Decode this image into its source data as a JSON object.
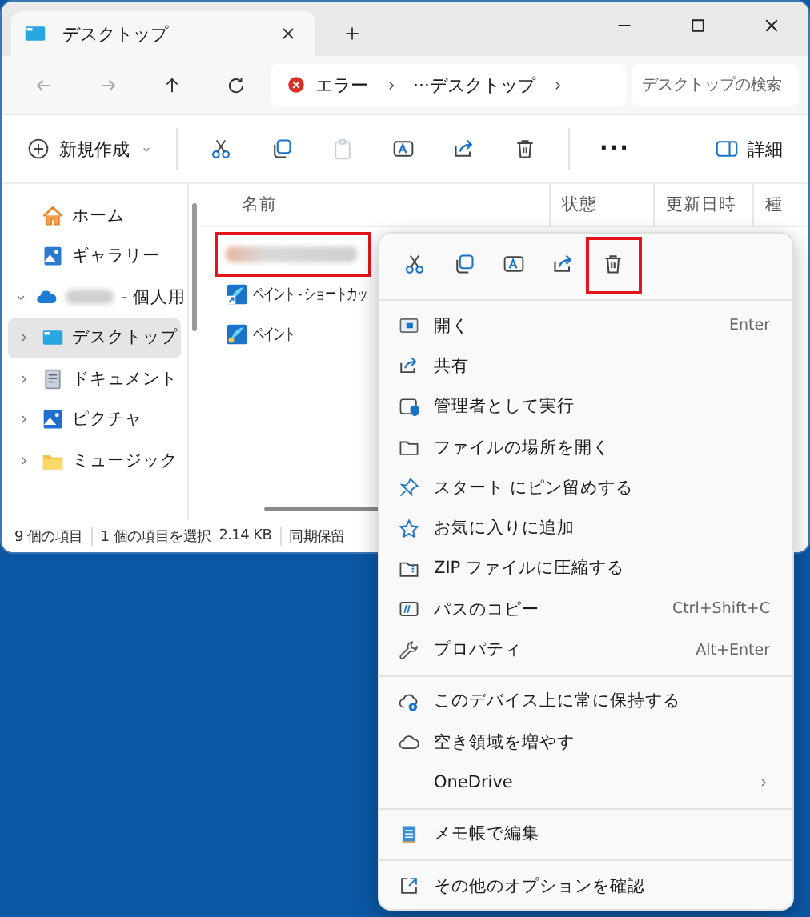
{
  "window": {
    "tab_title": "デスクトップ"
  },
  "navigation": {
    "breadcrumbs": [
      {
        "kind": "error",
        "label": "エラー"
      },
      {
        "kind": "overflow",
        "label": "···"
      },
      {
        "kind": "folder",
        "label": "デスクトップ"
      }
    ],
    "search": {
      "placeholder": "デスクトップの検索"
    }
  },
  "toolbar": {
    "new_label": "新規作成",
    "buttons": [
      {
        "kind": "cut",
        "disabled": false
      },
      {
        "kind": "copy",
        "disabled": false
      },
      {
        "kind": "paste",
        "disabled": true
      },
      {
        "kind": "rename",
        "disabled": false
      },
      {
        "kind": "share",
        "disabled": false
      },
      {
        "kind": "delete",
        "disabled": false
      }
    ],
    "more": "···",
    "details": "詳細"
  },
  "sidebar": {
    "items": [
      {
        "kind": "home",
        "label": "ホーム",
        "selected": false
      },
      {
        "kind": "gallery",
        "label": "ギャラリー",
        "selected": false
      },
      {
        "kind": "cloud",
        "label": "- 個人用",
        "expanded": true,
        "selected": false,
        "blurred_name": true
      },
      {
        "kind": "desktop",
        "label": "デスクトップ",
        "expanded": false,
        "selected": true
      },
      {
        "kind": "document",
        "label": "ドキュメント",
        "expanded": false,
        "selected": false
      },
      {
        "kind": "picture",
        "label": "ピクチャ",
        "expanded": false,
        "selected": false
      },
      {
        "kind": "folder",
        "label": "ミュージック",
        "expanded": false,
        "selected": false
      }
    ]
  },
  "file_list": {
    "columns": [
      "名前",
      "状態",
      "更新日時",
      "種"
    ],
    "rows": [
      {
        "kind": "blurred",
        "annotated": true
      },
      {
        "kind": "shortcut",
        "name": "ペイント - ショートカッ",
        "annotated": false
      },
      {
        "kind": "app",
        "name": "ペイント",
        "annotated": false
      }
    ]
  },
  "status_bar": [
    "9 個の項目",
    "1 個の項目を選択",
    "2.14 KB",
    "同期保留"
  ],
  "context_menu": {
    "quick_actions": [
      {
        "kind": "cut",
        "annotated": false
      },
      {
        "kind": "copy",
        "annotated": false
      },
      {
        "kind": "rename",
        "annotated": false
      },
      {
        "kind": "share",
        "annotated": false
      },
      {
        "kind": "delete",
        "annotated": true
      }
    ],
    "items": [
      {
        "kind": "open",
        "label": "開く",
        "shortcut": "Enter"
      },
      {
        "kind": "share",
        "label": "共有"
      },
      {
        "kind": "admin",
        "label": "管理者として実行"
      },
      {
        "kind": "folder",
        "label": "ファイルの場所を開く"
      },
      {
        "kind": "pin",
        "label": "スタート にピン留めする"
      },
      {
        "kind": "star",
        "label": "お気に入りに追加"
      },
      {
        "kind": "zip",
        "label": "ZIP ファイルに圧縮する"
      },
      {
        "kind": "path",
        "label": "パスのコピー",
        "shortcut": "Ctrl+Shift+C"
      },
      {
        "kind": "wrench",
        "label": "プロパティ",
        "shortcut": "Alt+Enter"
      },
      {
        "kind": "separator"
      },
      {
        "kind": "cloud-keep",
        "label": "このデバイス上に常に保持する"
      },
      {
        "kind": "cloud",
        "label": "空き領域を増やす"
      },
      {
        "kind": "submenu",
        "label": "OneDrive"
      },
      {
        "kind": "separator"
      },
      {
        "kind": "notepad",
        "label": "メモ帳で編集"
      },
      {
        "kind": "separator"
      },
      {
        "kind": "more",
        "label": "その他のオプションを確認"
      }
    ]
  }
}
